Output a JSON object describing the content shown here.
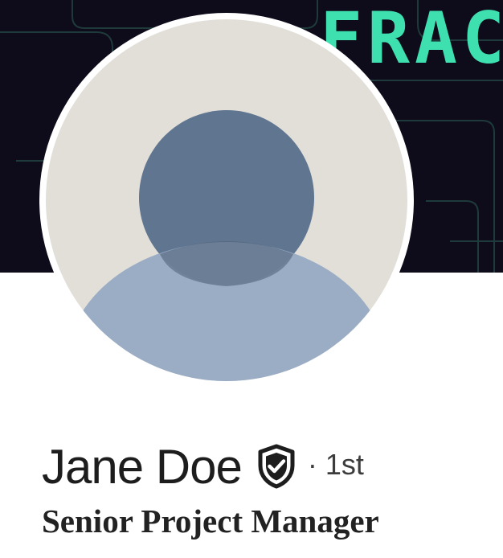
{
  "profile": {
    "name": "Jane Doe",
    "connection_degree": "· 1st",
    "headline": "Senior Project Manager"
  },
  "banner": {
    "visible_text": "FRAC"
  },
  "icons": {
    "verified": "verified-shield-icon",
    "avatar": "default-avatar-silhouette"
  },
  "colors": {
    "banner_background": "#0e0b1a",
    "banner_text": "#3fe0b0",
    "avatar_background": "#e2dfd9",
    "avatar_head": "#5f7590",
    "avatar_body": "#94a8c2",
    "name_text": "#1d1d1d"
  }
}
